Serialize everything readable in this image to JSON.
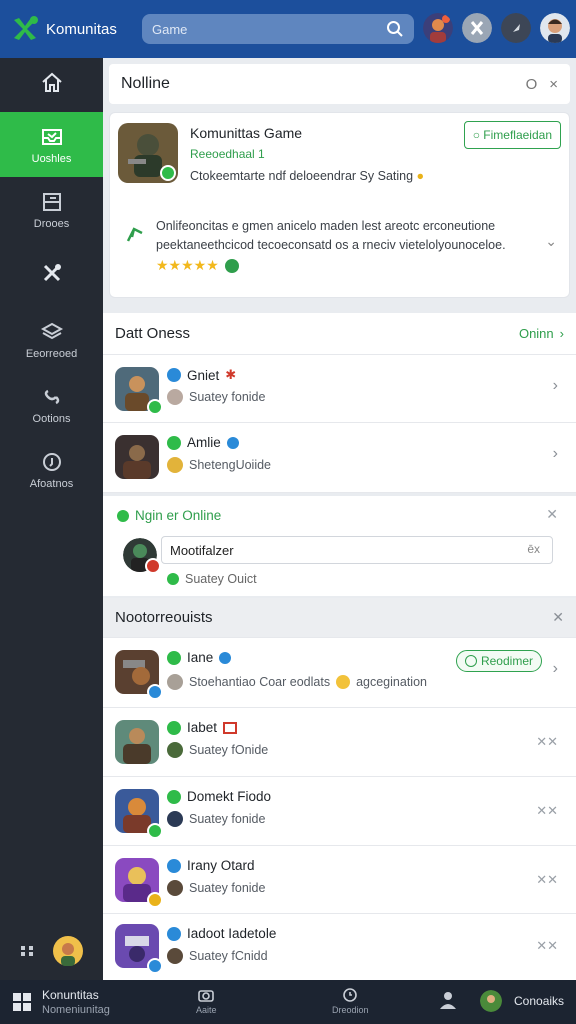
{
  "app": {
    "name": "Komunitas",
    "search_placeholder": "Game"
  },
  "colors": {
    "topbar": "#1c4f9c",
    "sidebar": "#252a33",
    "accent_green": "#2fbb49",
    "bottom_bar": "#1c2431"
  },
  "sidebar": {
    "items": [
      {
        "label": "",
        "icon": "home-icon"
      },
      {
        "label": "Uoshles",
        "icon": "inbox-icon",
        "active": true
      },
      {
        "label": "Drooes",
        "icon": "board-icon"
      },
      {
        "label": "",
        "icon": "tools-icon"
      },
      {
        "label": "Eeorreoed",
        "icon": "layers-icon"
      },
      {
        "label": "Ootions",
        "icon": "link-icon"
      },
      {
        "label": "Afoatnos",
        "icon": "shield-icon"
      }
    ]
  },
  "notif_panel": {
    "title": "Nolline",
    "minimize": "O",
    "close": "×"
  },
  "game_card": {
    "title": "Komunittas Game",
    "subtitle": "Reeoedhaal 1",
    "description": "Ctokeemtarte ndf deloeendrar Sy Sating",
    "follow_label": "Fimeflaeidan",
    "comment": "Onlifeoncitas e gmen anicelo maden lest areotc erconeutione peektaneethcicod tecoeconsatd os a rneciv vietelolyounoceloe.",
    "stars": "★★★★★",
    "rating": 5
  },
  "section_online": {
    "title": "Datt Oness",
    "right_label": "Oninn"
  },
  "friends": [
    {
      "name": "Gniet",
      "sub": "Suatey fonide"
    },
    {
      "name": "Amlie",
      "sub": "ShetengUoiide"
    }
  ],
  "online_box": {
    "title": "Ngin er Online",
    "input_value": "Mootifalzer",
    "input_clear": "ēx",
    "sub": "Suatey Ouict"
  },
  "section_notifications": {
    "title": "Nootorreouists"
  },
  "notifications": [
    {
      "name": "Iane",
      "sub": "Stoehantiao Coar eodlats",
      "sub_tail": "agcegination",
      "action": "Reodimer"
    },
    {
      "name": "Iabet",
      "sub": "Suatey fOnide"
    },
    {
      "name": "Domekt Fiodo",
      "sub": "Suatey fonide"
    },
    {
      "name": "Irany Otard",
      "sub": "Suatey fonide"
    },
    {
      "name": "Iadoot Iadetole",
      "sub": "Suatey fCnidd"
    }
  ],
  "bottom_bar": {
    "title": "Konuntitas",
    "subtitle": "Nomeniunitag",
    "tab1": "Aaite",
    "tab2": "Dreodion",
    "contacts": "Conoaiks"
  }
}
